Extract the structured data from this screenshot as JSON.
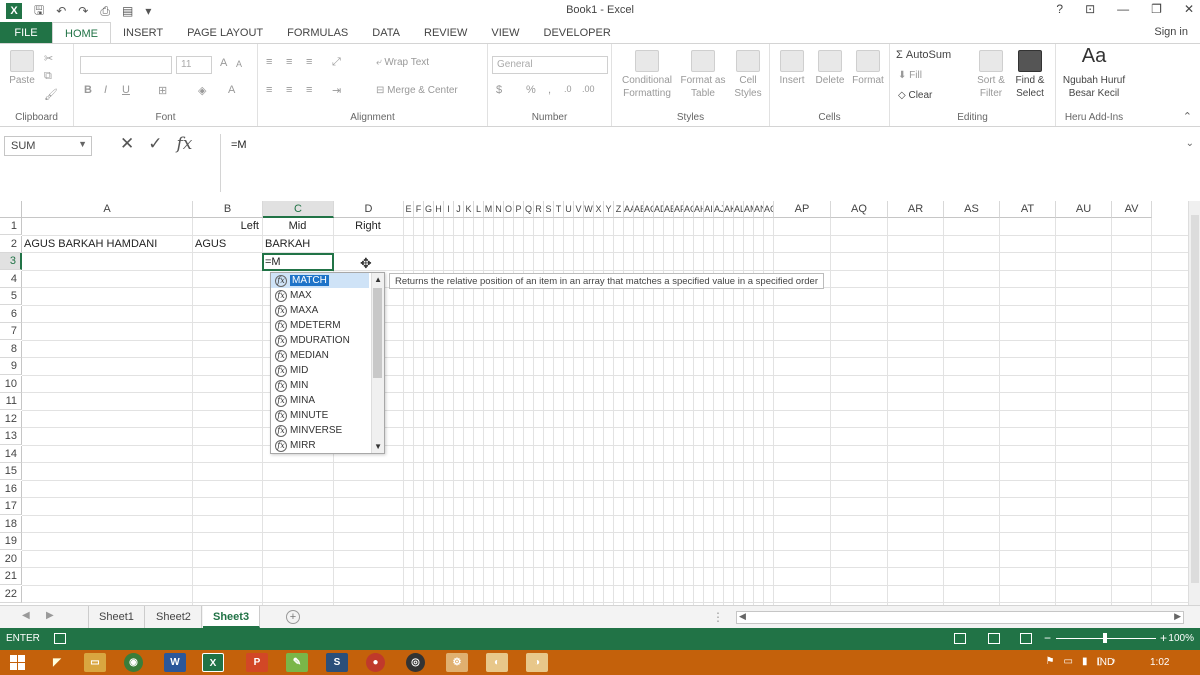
{
  "window": {
    "title": "Book1 - Excel",
    "help": "?",
    "minimize": "—",
    "restore": "❐",
    "close": "✕"
  },
  "tabs": [
    "FILE",
    "HOME",
    "INSERT",
    "PAGE LAYOUT",
    "FORMULAS",
    "DATA",
    "REVIEW",
    "VIEW",
    "DEVELOPER"
  ],
  "signin": "Sign in",
  "ribbon": {
    "clipboard": {
      "label": "Clipboard",
      "paste": "Paste"
    },
    "font": {
      "label": "Font",
      "name": "",
      "size": "11",
      "bold": "B",
      "italic": "I",
      "underline": "U",
      "grow": "A",
      "shrink": "A"
    },
    "alignment": {
      "label": "Alignment",
      "wrap": "Wrap Text",
      "merge": "Merge & Center"
    },
    "number": {
      "label": "Number",
      "format": "General",
      "percent": "%",
      "comma": ","
    },
    "styles": {
      "label": "Styles",
      "conditional": "Conditional Formatting",
      "table": "Format as Table",
      "cell": "Cell Styles"
    },
    "cells": {
      "label": "Cells",
      "insert": "Insert",
      "delete": "Delete",
      "format": "Format"
    },
    "editing": {
      "label": "Editing",
      "autosum": "AutoSum",
      "fill": "Fill",
      "clear": "Clear",
      "sort": "Sort & Filter",
      "find": "Find & Select"
    },
    "addins": {
      "label": "Heru Add-Ins",
      "caption": "Ngubah Huruf Besar Kecil",
      "glyph": "Aa"
    }
  },
  "formula_bar": {
    "name_box": "SUM",
    "cancel": "✕",
    "enter": "✓",
    "fx": "fx",
    "content": "=M"
  },
  "columns": [
    "A",
    "B",
    "C",
    "D",
    "E",
    "F",
    "G",
    "H",
    "I",
    "J",
    "K",
    "L",
    "M",
    "N",
    "O",
    "P",
    "Q",
    "R",
    "S",
    "T",
    "U",
    "V",
    "W",
    "X",
    "Y",
    "Z",
    "AA",
    "AB",
    "AC",
    "AD",
    "AE",
    "AF",
    "AG",
    "AH",
    "AI",
    "AJ",
    "AK",
    "AL",
    "AM",
    "AN",
    "AO",
    "AP",
    "AQ",
    "AR",
    "AS",
    "AT",
    "AU",
    "AV"
  ],
  "rows": [
    "1",
    "2",
    "3",
    "4",
    "5",
    "6",
    "7",
    "8",
    "9",
    "10",
    "11",
    "12",
    "13",
    "14",
    "15",
    "16",
    "17",
    "18",
    "19",
    "20",
    "21",
    "22"
  ],
  "cells": {
    "B1": "Left",
    "C1": "Mid",
    "D1": "Right",
    "A2": "AGUS BARKAH HAMDANI",
    "B2": "AGUS",
    "C2": "BARKAH",
    "C3": "=M"
  },
  "autocomplete": {
    "items": [
      "MATCH",
      "MAX",
      "MAXA",
      "MDETERM",
      "MDURATION",
      "MEDIAN",
      "MID",
      "MIN",
      "MINA",
      "MINUTE",
      "MINVERSE",
      "MIRR"
    ],
    "selected": "MATCH",
    "tooltip": "Returns the relative position of an item in an array that matches a specified value in a specified order"
  },
  "sheets": [
    "Sheet1",
    "Sheet2",
    "Sheet3"
  ],
  "active_sheet": "Sheet3",
  "status": {
    "mode": "ENTER",
    "zoom": "100%"
  },
  "taskbar": {
    "language": "IND",
    "time": "1:02"
  },
  "colors": {
    "excel_green": "#217346",
    "taskbar": "#c4610b",
    "selection_blue": "#1e73c8"
  }
}
